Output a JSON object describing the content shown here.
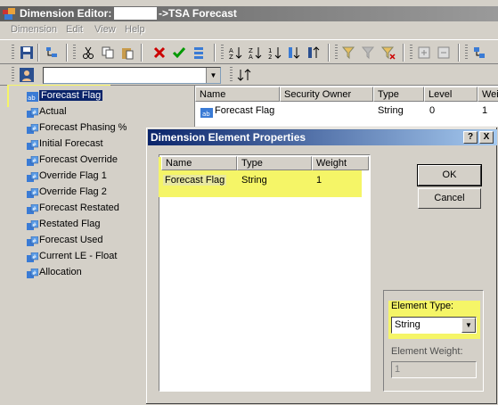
{
  "window": {
    "title_prefix": "Dimension Editor:",
    "title_suffix": "->TSA Forecast"
  },
  "menu": [
    "Dimension",
    "Edit",
    "View",
    "Help"
  ],
  "tree": {
    "items": [
      {
        "label": "Forecast Flag",
        "icon": "string-element-icon",
        "selected": true
      },
      {
        "label": "Actual",
        "icon": "numeric-element-icon"
      },
      {
        "label": "Forecast Phasing %",
        "icon": "numeric-element-icon"
      },
      {
        "label": "Initial Forecast",
        "icon": "numeric-element-icon"
      },
      {
        "label": "Forecast Override",
        "icon": "numeric-element-icon"
      },
      {
        "label": "Override Flag 1",
        "icon": "numeric-element-icon"
      },
      {
        "label": "Override Flag 2",
        "icon": "numeric-element-icon"
      },
      {
        "label": "Forecast Restated",
        "icon": "numeric-element-icon"
      },
      {
        "label": "Restated Flag",
        "icon": "numeric-element-icon"
      },
      {
        "label": "Forecast Used",
        "icon": "numeric-element-icon"
      },
      {
        "label": "Current LE - Float",
        "icon": "numeric-element-icon"
      },
      {
        "label": "Allocation",
        "icon": "numeric-element-icon"
      }
    ]
  },
  "list": {
    "columns": [
      "Name",
      "Security Owner",
      "Type",
      "Level",
      "Weig"
    ],
    "row": {
      "name": "Forecast Flag",
      "security_owner": "",
      "type": "String",
      "level": "0",
      "weight": "1"
    }
  },
  "dialog": {
    "title": "Dimension Element Properties",
    "help_btn": "?",
    "close_btn": "X",
    "columns": [
      "Name",
      "Type",
      "Weight"
    ],
    "row": {
      "name": "Forecast Flag",
      "type": "String",
      "weight": "1"
    },
    "ok_label": "OK",
    "cancel_label": "Cancel",
    "element_type_label": "Element Type:",
    "element_type_value": "String",
    "element_weight_label": "Element Weight:",
    "element_weight_value": "1"
  },
  "colors": {
    "highlight": "#f5f567",
    "title_active": "#0a246a"
  }
}
